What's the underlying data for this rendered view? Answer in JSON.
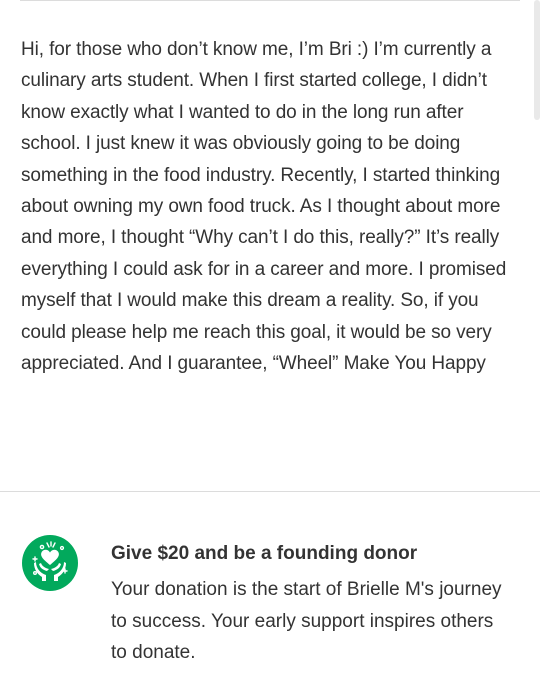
{
  "story": {
    "text": "Hi, for those who don’t know me, I’m Bri :) I’m currently a culinary arts student. When I first started college, I didn’t know exactly what I wanted to do in the long run after school. I just knew it was obviously going to be doing something in the food industry. Recently, I started thinking about owning my own food truck. As I thought about more and more, I thought “Why can’t I do this, really?” It’s really everything I could ask for in a career and more. I promised myself that I would make this dream a reality. So, if you could please help me reach this goal, it would be so very appreciated. And I guarantee, “Wheel” Make You Happy"
  },
  "founding_donor": {
    "icon": "heart-hands-badge-icon",
    "title": "Give $20 and be a founding donor",
    "description": "Your donation is the start of Brielle M's journey to success. Your early support inspires others to donate."
  },
  "colors": {
    "accent": "#02a95c",
    "text": "#333333",
    "divider": "#dcdcdc"
  }
}
